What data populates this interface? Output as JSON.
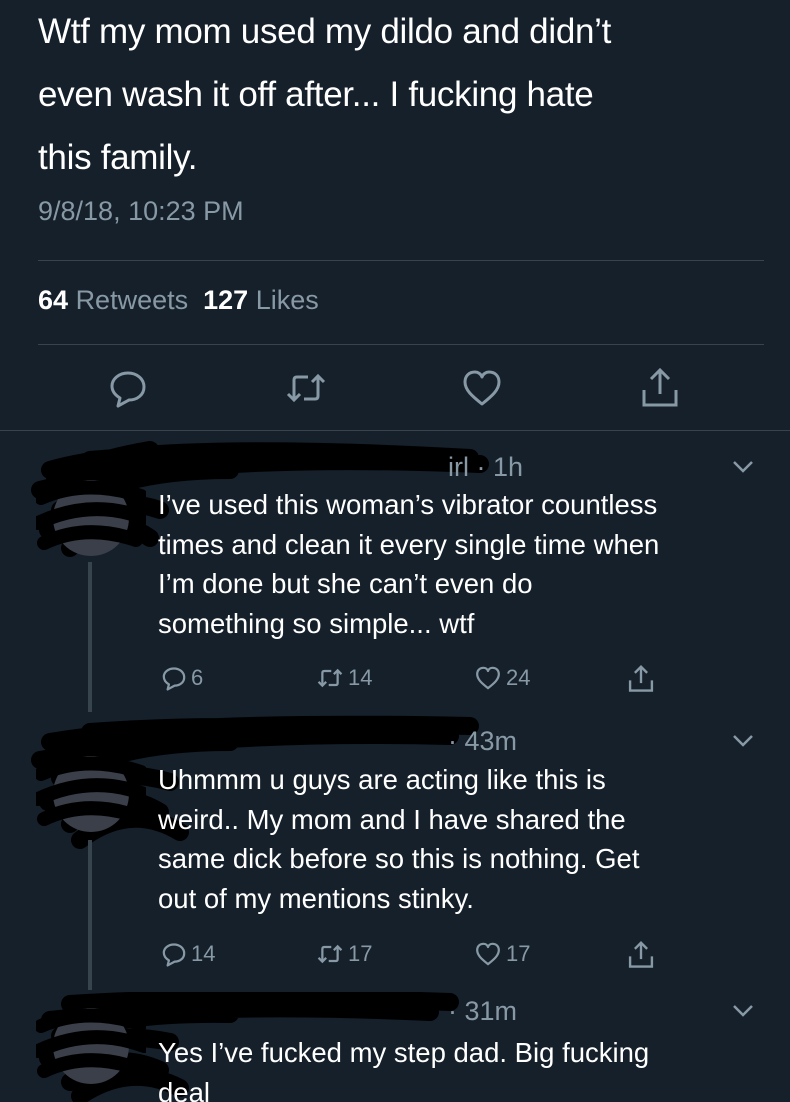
{
  "tweet": {
    "text": "Wtf my mom used my dildo and didn’t even wash it off after... I fucking hate this family.",
    "line1": "Wtf my mom used my dildo and didn’t",
    "line2": "even wash it off after... I fucking hate",
    "line3": "this family.",
    "timestamp": "9/8/18, 10:23 PM",
    "retweets_count": "64",
    "retweets_label": "Retweets",
    "likes_count": "127",
    "likes_label": "Likes"
  },
  "replies": [
    {
      "handle_visible_suffix": "irl",
      "time": "· 1h",
      "text_lines": [
        "I’ve used this woman’s vibrator countless",
        "times and clean it every single time when",
        "I’m done but she can’t even do",
        "something so simple... wtf"
      ],
      "reply_count": "6",
      "retweet_count": "14",
      "like_count": "24"
    },
    {
      "handle_visible_suffix": "",
      "time": "· 43m",
      "text_lines": [
        "Uhmmm u guys are acting like this is",
        "weird.. My mom and I have shared the",
        "same dick before so this is nothing. Get",
        "out of my mentions stinky."
      ],
      "reply_count": "14",
      "retweet_count": "17",
      "like_count": "17"
    },
    {
      "handle_visible_suffix": "",
      "time": "· 31m",
      "text_lines": [
        "Yes I’ve fucked my step dad. Big fucking",
        "deal"
      ]
    }
  ],
  "icons": {
    "reply": "reply-icon",
    "retweet": "retweet-icon",
    "like": "heart-icon",
    "share": "share-icon",
    "more": "chevron-down-icon"
  },
  "colors": {
    "background": "#15202b",
    "secondary_text": "#8899a6",
    "divider": "#38444d"
  }
}
